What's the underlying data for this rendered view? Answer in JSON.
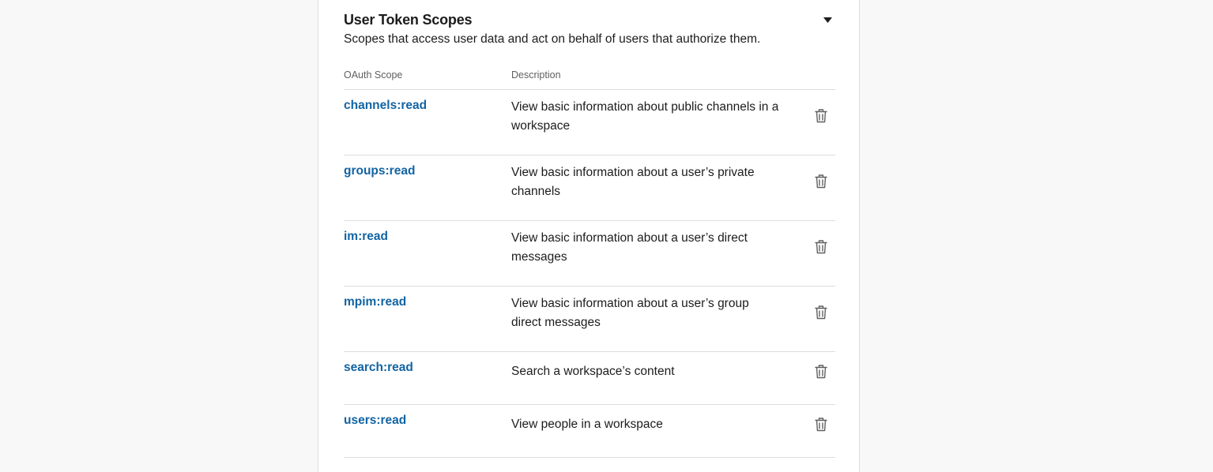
{
  "section": {
    "title": "User Token Scopes",
    "subtitle": "Scopes that access user data and act on behalf of users that authorize them.",
    "collapse_icon": "caret-down-icon"
  },
  "table": {
    "headers": {
      "scope": "OAuth Scope",
      "description": "Description"
    },
    "delete_icon": "trash-icon",
    "rows": [
      {
        "scope": "channels:read",
        "description": "View basic information about public channels in a workspace"
      },
      {
        "scope": "groups:read",
        "description": "View basic information about a user’s private channels"
      },
      {
        "scope": "im:read",
        "description": "View basic information about a user’s direct messages"
      },
      {
        "scope": "mpim:read",
        "description": "View basic information about a user’s group direct messages"
      },
      {
        "scope": "search:read",
        "description": "Search a workspace’s content"
      },
      {
        "scope": "users:read",
        "description": "View people in a workspace"
      }
    ]
  },
  "colors": {
    "link": "#1264a3",
    "text": "#1d1c1d",
    "muted": "#616061",
    "divider": "#dddddd",
    "page_background": "#f8f8f8"
  }
}
